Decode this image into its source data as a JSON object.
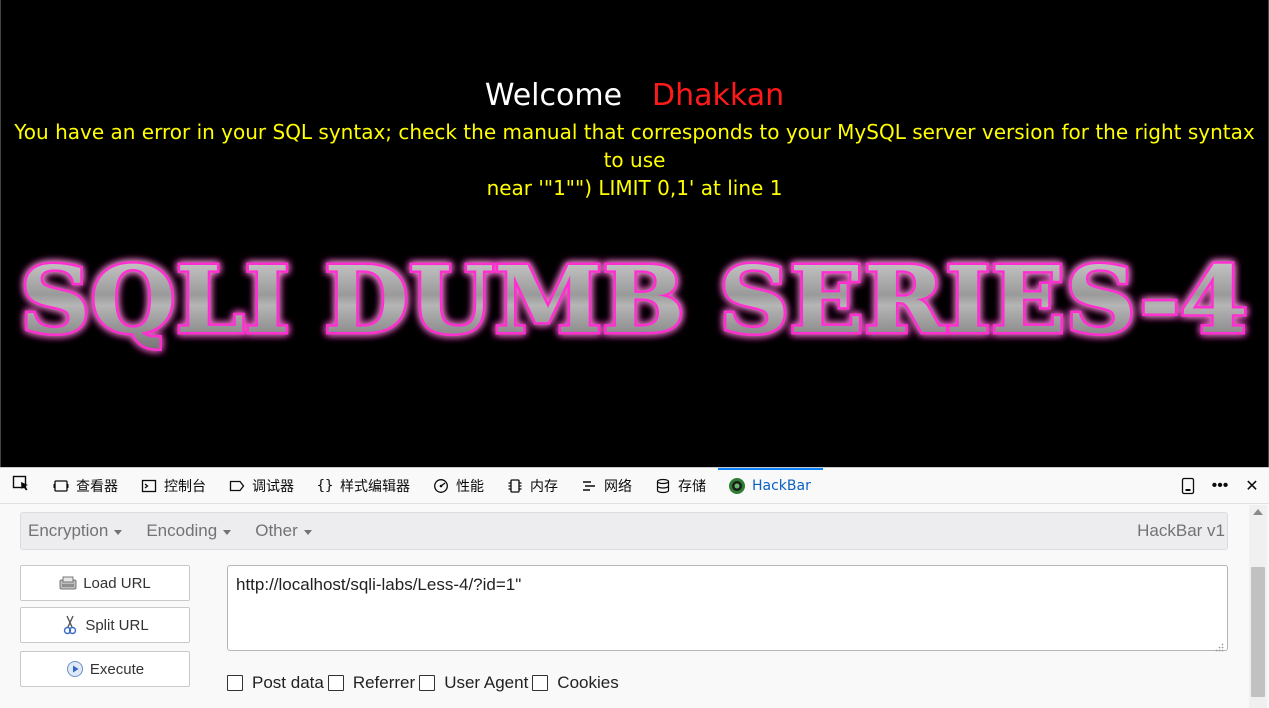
{
  "page": {
    "welcome_word": "Welcome",
    "user_name": "Dhakkan",
    "sql_error_line1": "You have an error in your SQL syntax; check the manual that corresponds to your MySQL server version for the right syntax to use",
    "sql_error_line2": "near '\"1\"\") LIMIT 0,1' at line 1",
    "banner_text": "SQLI DUMB SERIES-4"
  },
  "devtools": {
    "tabs": [
      {
        "label": "查看器",
        "icon": "inspector-icon"
      },
      {
        "label": "控制台",
        "icon": "console-icon"
      },
      {
        "label": "调试器",
        "icon": "debugger-icon"
      },
      {
        "label": "样式编辑器",
        "icon": "style-editor-icon"
      },
      {
        "label": "性能",
        "icon": "performance-icon"
      },
      {
        "label": "内存",
        "icon": "memory-icon"
      },
      {
        "label": "网络",
        "icon": "network-icon"
      },
      {
        "label": "存储",
        "icon": "storage-icon"
      },
      {
        "label": "HackBar",
        "icon": "hackbar-icon",
        "active": true
      }
    ]
  },
  "hackbar": {
    "menu": {
      "encryption": "Encryption",
      "encoding": "Encoding",
      "other": "Other",
      "version": "HackBar v1"
    },
    "buttons": {
      "load_url": "Load URL",
      "split_url": "Split URL",
      "execute": "Execute"
    },
    "url_value": "http://localhost/sqli-labs/Less-4/?id=1\"",
    "options": {
      "post_data": "Post data",
      "referrer": "Referrer",
      "user_agent": "User Agent",
      "cookies": "Cookies"
    }
  },
  "colors": {
    "error_text": "#ffff00",
    "user_name": "#ff1a1a",
    "banner_glow": "#ff2fd0",
    "active_tab": "#0a84ff"
  }
}
